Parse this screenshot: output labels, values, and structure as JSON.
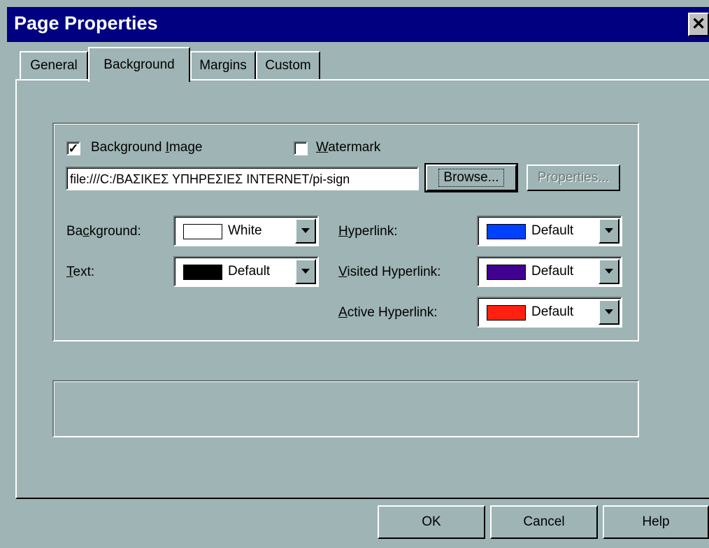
{
  "window": {
    "title": "Page Properties",
    "close_glyph": "✕"
  },
  "tabs": [
    {
      "label": "General",
      "active": false
    },
    {
      "label": "Background",
      "active": true
    },
    {
      "label": "Margins",
      "active": false
    },
    {
      "label": "Custom",
      "active": false
    }
  ],
  "background_tab": {
    "bg_image": {
      "label": "Background Image",
      "checked": true,
      "mnemonic": "I"
    },
    "watermark": {
      "label": "Watermark",
      "checked": false,
      "mnemonic": "W"
    },
    "image_path": "file:///C:/ΒΑΣΙΚΕΣ ΥΠΗΡΕΣΙΕΣ INTERNET/pi-sign",
    "browse_label": "Browse...",
    "properties_label": "Properties...",
    "colors": {
      "background": {
        "label": "Background:",
        "value": "White",
        "swatch": "#ffffff"
      },
      "text": {
        "label": "Text:",
        "value": "Default",
        "swatch": "#000000"
      },
      "hyperlink": {
        "label": "Hyperlink:",
        "value": "Default",
        "swatch": "#0040ff"
      },
      "visited_hyperlink": {
        "label": "Visited Hyperlink:",
        "value": "Default",
        "swatch": "#400090"
      },
      "active_hyperlink": {
        "label": "Active Hyperlink:",
        "value": "Default",
        "swatch": "#ff2010"
      }
    }
  },
  "footer": {
    "ok_label": "OK",
    "cancel_label": "Cancel",
    "help_label": "Help"
  },
  "theme": {
    "face": "#9fb4b4",
    "titlebar": "#000080"
  }
}
